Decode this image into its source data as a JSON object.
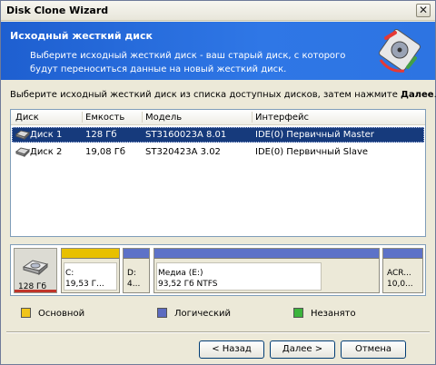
{
  "window": {
    "title": "Disk Clone Wizard",
    "close_glyph": "✕"
  },
  "header": {
    "title": "Исходный жесткий диск",
    "description": "Выберите исходный жесткий диск - ваш старый диск, с которого будут переноситься данные на новый жесткий диск.",
    "icon": "disk-clone-icon"
  },
  "instruction": {
    "text": "Выберите исходный жесткий диск из списка доступных дисков, затем нажмите ",
    "bold": "Далее",
    "end": "."
  },
  "table": {
    "columns": [
      "Диск",
      "Емкость",
      "Модель",
      "Интерфейс"
    ],
    "rows": [
      {
        "disk": "Диск 1",
        "capacity": "128 Гб",
        "model": "ST3160023A 8.01",
        "interface": "IDE(0) Первичный Master",
        "selected": true
      },
      {
        "disk": "Диск 2",
        "capacity": "19,08 Гб",
        "model": "ST320423A 3.02",
        "interface": "IDE(0) Первичный Slave",
        "selected": false
      }
    ]
  },
  "disk_map": {
    "disk_label": "128 Гб",
    "partitions": [
      {
        "line1": "C:",
        "line2": "19,53 Г...",
        "type": "primary"
      },
      {
        "line1": "D:",
        "line2": "4...",
        "type": "logical"
      },
      {
        "line1": "Медиа (E:)",
        "line2": "93,52 Гб  NTFS",
        "type": "logical"
      },
      {
        "line1": "ACR...",
        "line2": "10,0...",
        "type": "logical"
      }
    ]
  },
  "legend": [
    {
      "label": "Основной",
      "color": "#f0c419"
    },
    {
      "label": "Логический",
      "color": "#5c6bc0"
    },
    {
      "label": "Незанято",
      "color": "#3cb43c"
    }
  ],
  "buttons": {
    "back": "< Назад",
    "next": "Далее >",
    "cancel": "Отмена"
  },
  "colors": {
    "primary_band": "#e8c000",
    "logical_band": "#5d72c8",
    "selection": "#163a7c",
    "header": "#2d6fe0"
  }
}
